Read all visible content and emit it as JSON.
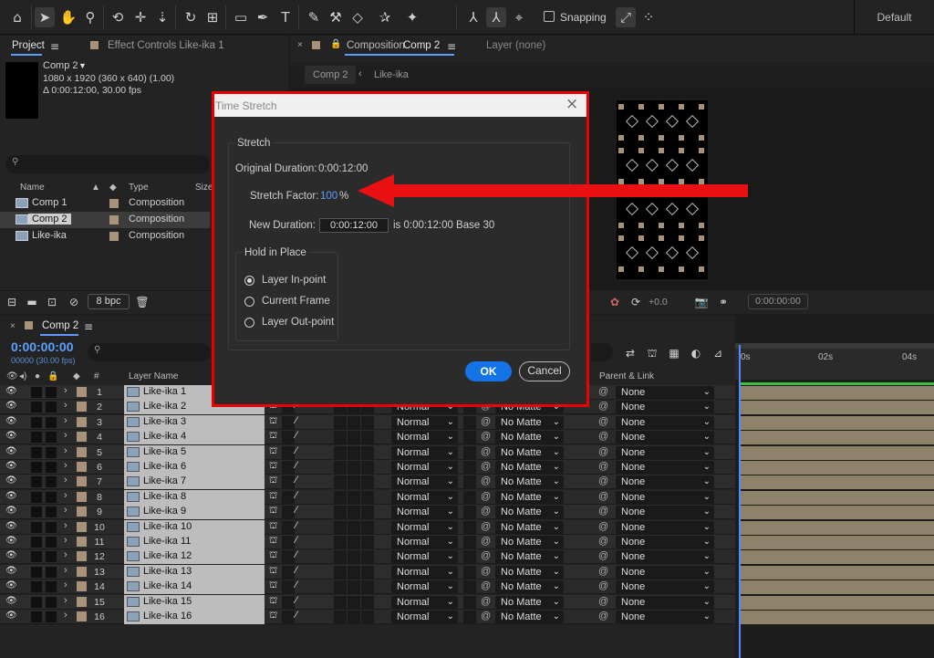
{
  "toolbar": {
    "snapping_label": "Snapping",
    "workspace": "Default"
  },
  "project_panel": {
    "tab_project": "Project",
    "tab_effect_controls": "Effect Controls Like-ika 1",
    "comp_name": "Comp 2",
    "dims": "1080 x 1920  (360 x 640) (1.00)",
    "duration": "Δ 0:00:12:00, 30.00 fps",
    "columns": {
      "name": "Name",
      "type": "Type",
      "size": "Size"
    },
    "items": [
      {
        "name": "Comp 1",
        "type": "Composition"
      },
      {
        "name": "Comp 2",
        "type": "Composition"
      },
      {
        "name": "Like-ika",
        "type": "Composition"
      }
    ],
    "bpc": "8 bpc"
  },
  "comp_panel": {
    "tab_label": "Composition",
    "tab_comp": "Comp 2",
    "tab_layer": "Layer (none)",
    "crumb_comp": "Comp 2",
    "crumb_sub": "Like-ika",
    "exposure": "+0.0",
    "timecode": "0:00:00:00"
  },
  "timeline": {
    "tab": "Comp 2",
    "timecode": "0:00:00:00",
    "fps": "00000 (30.00 fps)",
    "col_layer_name": "Layer Name",
    "col_parent": "Parent & Link",
    "col_num": "#",
    "ticks": [
      "0s",
      "02s",
      "04s"
    ],
    "layers": [
      {
        "num": "1",
        "name": "Like-ika 1",
        "mode": "Normal",
        "matte": "No Matte",
        "parent": "None"
      },
      {
        "num": "2",
        "name": "Like-ika 2",
        "mode": "Normal",
        "matte": "No Matte",
        "parent": "None"
      },
      {
        "num": "3",
        "name": "Like-ika 3",
        "mode": "Normal",
        "matte": "No Matte",
        "parent": "None"
      },
      {
        "num": "4",
        "name": "Like-ika 4",
        "mode": "Normal",
        "matte": "No Matte",
        "parent": "None"
      },
      {
        "num": "5",
        "name": "Like-ika 5",
        "mode": "Normal",
        "matte": "No Matte",
        "parent": "None"
      },
      {
        "num": "6",
        "name": "Like-ika 6",
        "mode": "Normal",
        "matte": "No Matte",
        "parent": "None"
      },
      {
        "num": "7",
        "name": "Like-ika 7",
        "mode": "Normal",
        "matte": "No Matte",
        "parent": "None"
      },
      {
        "num": "8",
        "name": "Like-ika 8",
        "mode": "Normal",
        "matte": "No Matte",
        "parent": "None"
      },
      {
        "num": "9",
        "name": "Like-ika 9",
        "mode": "Normal",
        "matte": "No Matte",
        "parent": "None"
      },
      {
        "num": "10",
        "name": "Like-ika 10",
        "mode": "Normal",
        "matte": "No Matte",
        "parent": "None"
      },
      {
        "num": "11",
        "name": "Like-ika 11",
        "mode": "Normal",
        "matte": "No Matte",
        "parent": "None"
      },
      {
        "num": "12",
        "name": "Like-ika 12",
        "mode": "Normal",
        "matte": "No Matte",
        "parent": "None"
      },
      {
        "num": "13",
        "name": "Like-ika 13",
        "mode": "Normal",
        "matte": "No Matte",
        "parent": "None"
      },
      {
        "num": "14",
        "name": "Like-ika 14",
        "mode": "Normal",
        "matte": "No Matte",
        "parent": "None"
      },
      {
        "num": "15",
        "name": "Like-ika 15",
        "mode": "Normal",
        "matte": "No Matte",
        "parent": "None"
      },
      {
        "num": "16",
        "name": "Like-ika 16",
        "mode": "Normal",
        "matte": "No Matte",
        "parent": "None"
      }
    ]
  },
  "dialog": {
    "title": "Time Stretch",
    "group_stretch": "Stretch",
    "original_label": "Original Duration:",
    "original_value": "0:00:12:00",
    "factor_label": "Stretch Factor:",
    "factor_value": "100",
    "factor_unit": "%",
    "new_label": "New Duration:",
    "new_value": "0:00:12:00",
    "new_info": "is 0:00:12:00  Base 30",
    "group_hold": "Hold in Place",
    "options": [
      "Layer In-point",
      "Current Frame",
      "Layer Out-point"
    ],
    "selected_option": "Layer In-point",
    "ok": "OK",
    "cancel": "Cancel"
  },
  "annotation": {
    "arrow_color": "#e81010",
    "highlight_color": "#ee0000"
  }
}
